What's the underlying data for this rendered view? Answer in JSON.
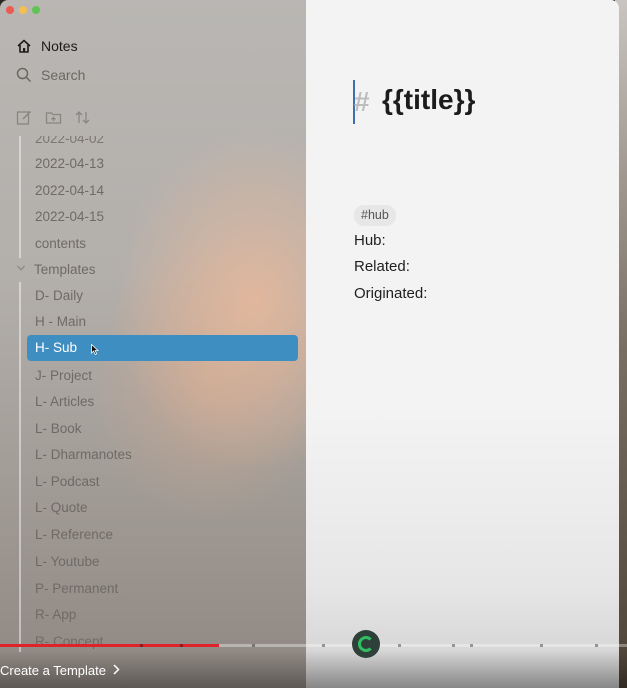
{
  "app": {
    "accent": "#3e8ec2"
  },
  "sidebar": {
    "notes_label": "Notes",
    "search_placeholder": "Search",
    "items_above": [
      "2022-04-02",
      "2022-04-13",
      "2022-04-14",
      "2022-04-15",
      "contents"
    ],
    "group_label": "Templates",
    "templates": [
      "D- Daily",
      "H - Main",
      "H- Sub",
      "J- Project",
      "L- Articles",
      "L- Book",
      "L- Dharmanotes",
      "L- Podcast",
      "L- Quote",
      "L- Reference",
      "L- Youtube",
      "P- Permanent",
      "R- App",
      "R- Concept"
    ],
    "selected_item": "H- Sub"
  },
  "editor": {
    "heading_marker": "#",
    "heading_text": "{{title}}",
    "tag": "#hub",
    "fields": [
      "Hub:",
      "Related:",
      "Originated:"
    ]
  },
  "video": {
    "played_fraction": 0.35,
    "caption": "Create a Template",
    "caption_icon": "chevron-right-icon"
  }
}
